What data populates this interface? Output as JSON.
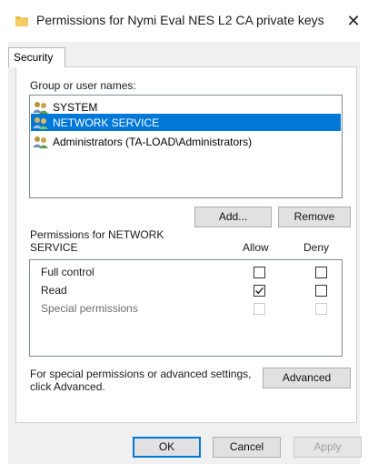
{
  "window": {
    "title": "Permissions for Nymi Eval NES L2 CA private keys",
    "close_glyph": "✕"
  },
  "tabs": [
    {
      "label": "Security",
      "active": true
    }
  ],
  "group": {
    "label": "Group or user names:",
    "users": [
      {
        "name": "SYSTEM",
        "selected": false,
        "icon": "users-icon"
      },
      {
        "name": "NETWORK SERVICE",
        "selected": true,
        "icon": "users-icon"
      },
      {
        "name": "Administrators (TA-LOAD\\Administrators)",
        "selected": false,
        "icon": "users-icon"
      }
    ],
    "add_label": "Add...",
    "remove_label": "Remove"
  },
  "permissions": {
    "heading_line1": "Permissions for NETWORK",
    "heading_line2": "SERVICE",
    "allow_label": "Allow",
    "deny_label": "Deny",
    "rows": [
      {
        "name": "Full control",
        "allow": false,
        "deny": false,
        "enabled": true
      },
      {
        "name": "Read",
        "allow": true,
        "deny": false,
        "enabled": true
      },
      {
        "name": "Special permissions",
        "allow": false,
        "deny": false,
        "enabled": false
      }
    ]
  },
  "advanced": {
    "text_line1": "For special permissions or advanced settings,",
    "text_line2": "click Advanced.",
    "button_label": "Advanced"
  },
  "footer": {
    "ok_label": "OK",
    "cancel_label": "Cancel",
    "apply_label": "Apply"
  },
  "colors": {
    "selection": "#0078d7",
    "dialog_bg": "#f0f0f0",
    "button_bg": "#e1e1e1"
  }
}
